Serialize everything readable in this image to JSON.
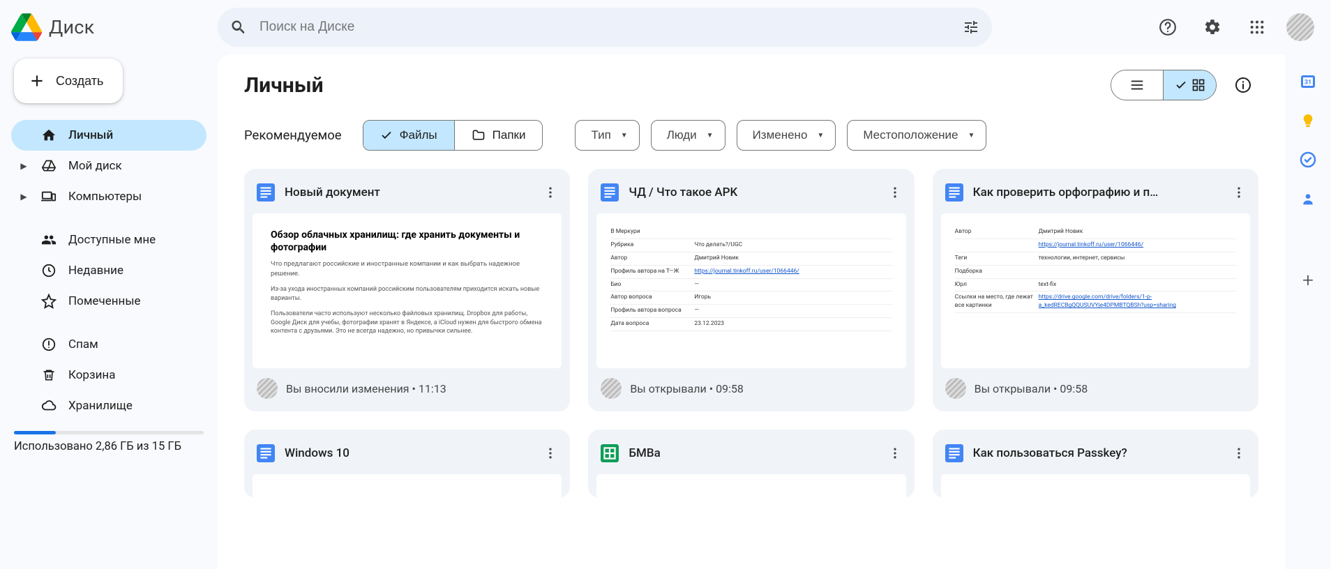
{
  "app": {
    "name": "Диск"
  },
  "search": {
    "placeholder": "Поиск на Диске"
  },
  "sidebar": {
    "new_label": "Создать",
    "items": [
      {
        "label": "Личный"
      },
      {
        "label": "Мой диск"
      },
      {
        "label": "Компьютеры"
      },
      {
        "label": "Доступные мне"
      },
      {
        "label": "Недавние"
      },
      {
        "label": "Помеченные"
      },
      {
        "label": "Спам"
      },
      {
        "label": "Корзина"
      },
      {
        "label": "Хранилище"
      }
    ],
    "storage_text": "Использовано 2,86 ГБ из 15 ГБ"
  },
  "main": {
    "title": "Личный",
    "recommended_label": "Рекомендуемое",
    "seg_files": "Файлы",
    "seg_folders": "Папки",
    "chips": {
      "type": "Тип",
      "people": "Люди",
      "modified": "Изменено",
      "location": "Местоположение"
    },
    "cards": [
      {
        "title": "Новый документ",
        "footer": "Вы вносили изменения • 11:13",
        "type": "doc",
        "preview": {
          "h": "Обзор облачных хранилищ: где хранить документы и фотографии",
          "sub": "Что предлагают российские и иностранные компании и как выбрать надежное решение.",
          "p1": "Из-за ухода иностранных компаний российским пользователям приходится искать новые варианты.",
          "p2": "Пользователи часто используют несколько файловых хранилищ. Dropbox для работы, Google Диск для учебы, фотографии хранят в Яндексе, а iCloud нужен для быстрого обмена контента с друзьями. Это не всегда надежно, но привычки сильнее."
        }
      },
      {
        "title": "ЧД / Что такое APK",
        "footer": "Вы открывали • 09:58",
        "type": "doc",
        "preview_table": [
          {
            "k": "В Меркури",
            "v": ""
          },
          {
            "k": "Рубрика",
            "v": "Что делать?/UGC"
          },
          {
            "k": "Автор",
            "v": "Дмитрий Новик"
          },
          {
            "k": "Профиль автора на Т—Ж",
            "v": "https://journal.tinkoff.ru/user/1066446/",
            "link": true
          },
          {
            "k": "Био",
            "v": "—"
          },
          {
            "k": "Автор вопроса",
            "v": "Игорь"
          },
          {
            "k": "Профиль автора вопроса",
            "v": "—"
          },
          {
            "k": "Дата вопроса",
            "v": "23.12.2023"
          }
        ]
      },
      {
        "title": "Как проверить орфографию и п…",
        "footer": "Вы открывали • 09:58",
        "type": "doc",
        "preview_table": [
          {
            "k": "Автор",
            "v": "Дмитрий Новик"
          },
          {
            "k": "",
            "v": "https://journal.tinkoff.ru/user/1066446/",
            "link": true
          },
          {
            "k": "Теги",
            "v": "технологии, интернет, сервисы"
          },
          {
            "k": "Подборка",
            "v": ""
          },
          {
            "k": "Юрл",
            "v": "text-fix"
          },
          {
            "k": "Ссылки на место, где лежат все картинки",
            "v": "https://drive.google.com/drive/folders/1-p-a_kedRECBgQQUSUVYje4DPMBTQBSh?usp=sharing",
            "link": true
          }
        ]
      },
      {
        "title": "Windows 10",
        "type": "doc"
      },
      {
        "title": "БМВа",
        "type": "sheet"
      },
      {
        "title": "Как пользоваться Passkey?",
        "type": "doc"
      }
    ]
  }
}
